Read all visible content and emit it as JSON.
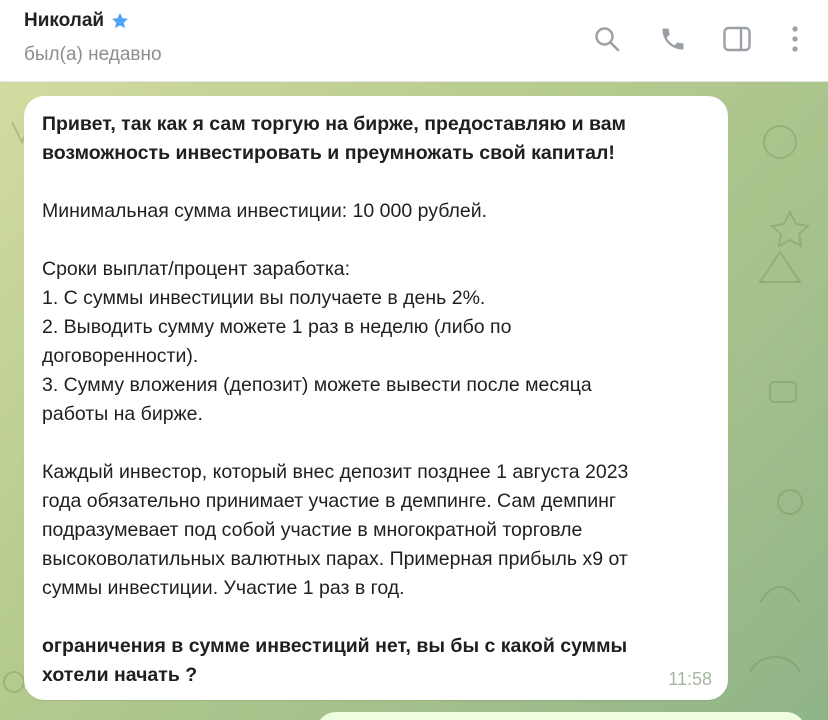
{
  "header": {
    "name": "Николай",
    "status": "был(а) недавно",
    "icons": [
      "star-icon",
      "search-icon",
      "phone-icon",
      "sidebar-toggle-icon",
      "more-vertical-icon"
    ]
  },
  "message": {
    "line1": "Привет, так как я сам торгую на бирже, предоставляю и вам",
    "line2": "возможность инвестировать и преумножать свой капитал!",
    "line3": "Минимальная сумма инвестиции: 10 000 рублей.",
    "line4": "Сроки выплат/процент заработка:",
    "line5": "1. С суммы инвестиции вы получаете в день 2%.",
    "line6": "2. Выводить сумму можете 1 раз в неделю (либо по",
    "line7": "договоренности).",
    "line8": "3. Сумму вложения (депозит) можете вывести после месяца",
    "line9": "работы на бирже.",
    "line10": "Каждый инвестор, который внес депозит позднее 1 августа 2023",
    "line11": "года обязательно принимает участие в демпинге. Сам демпинг",
    "line12": "подразумевает под собой участие в многократной  торговле",
    "line13": "высоковолатильных валютных парах. Примерная прибыль х9 от",
    "line14": "суммы инвестиции. Участие 1 раз в год.",
    "line15": "ограничения в сумме инвестиций нет, вы бы с какой суммы",
    "line16": "хотели начать ?",
    "time": "11:58"
  },
  "colors": {
    "accent": "#4ea4f5",
    "icon": "#9aa0a6",
    "bubble": "#ffffff"
  }
}
